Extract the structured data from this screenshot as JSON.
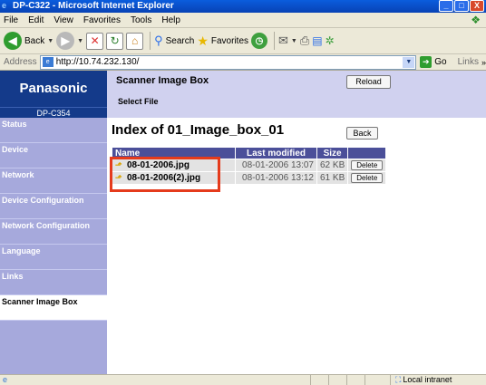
{
  "window": {
    "title": "DP-C322 - Microsoft Internet Explorer",
    "minimize": "_",
    "maximize": "□",
    "close": "X"
  },
  "menu": [
    "File",
    "Edit",
    "View",
    "Favorites",
    "Tools",
    "Help"
  ],
  "toolbar": {
    "back_label": "Back",
    "search_label": "Search",
    "favorites_label": "Favorites"
  },
  "address": {
    "label": "Address",
    "url": "http://10.74.232.130/",
    "go_label": "Go",
    "links_label": "Links"
  },
  "sidebar": {
    "brand": "Panasonic",
    "model": "DP-C354",
    "items": [
      {
        "label": "Status",
        "active": false
      },
      {
        "label": "Device",
        "active": false
      },
      {
        "label": "Network",
        "active": false
      },
      {
        "label": "Device Configuration",
        "active": false
      },
      {
        "label": "Network Configuration",
        "active": false
      },
      {
        "label": "Language",
        "active": false
      },
      {
        "label": "Links",
        "active": false
      },
      {
        "label": "Scanner Image Box",
        "active": true
      }
    ]
  },
  "panel": {
    "title": "Scanner Image Box",
    "subtitle": "Select File",
    "reload_label": "Reload"
  },
  "index": {
    "title": "Index of 01_Image_box_01",
    "back_label": "Back",
    "columns": [
      "Name",
      "Last modified",
      "Size"
    ],
    "files": [
      {
        "name": "08-01-2006.jpg",
        "modified": "08-01-2006 13:07",
        "size": "62 KB",
        "delete_label": "Delete"
      },
      {
        "name": "08-01-2006(2).jpg",
        "modified": "08-01-2006 13:12",
        "size": "61 KB",
        "delete_label": "Delete"
      }
    ]
  },
  "status": {
    "zone": "Local intranet"
  },
  "colors": {
    "sidebar_bg": "#a6a9dc",
    "brand_bg": "#143a8a",
    "panel_bg": "#d0d1ef",
    "table_header": "#4b4f99",
    "highlight": "#e53b1c"
  }
}
